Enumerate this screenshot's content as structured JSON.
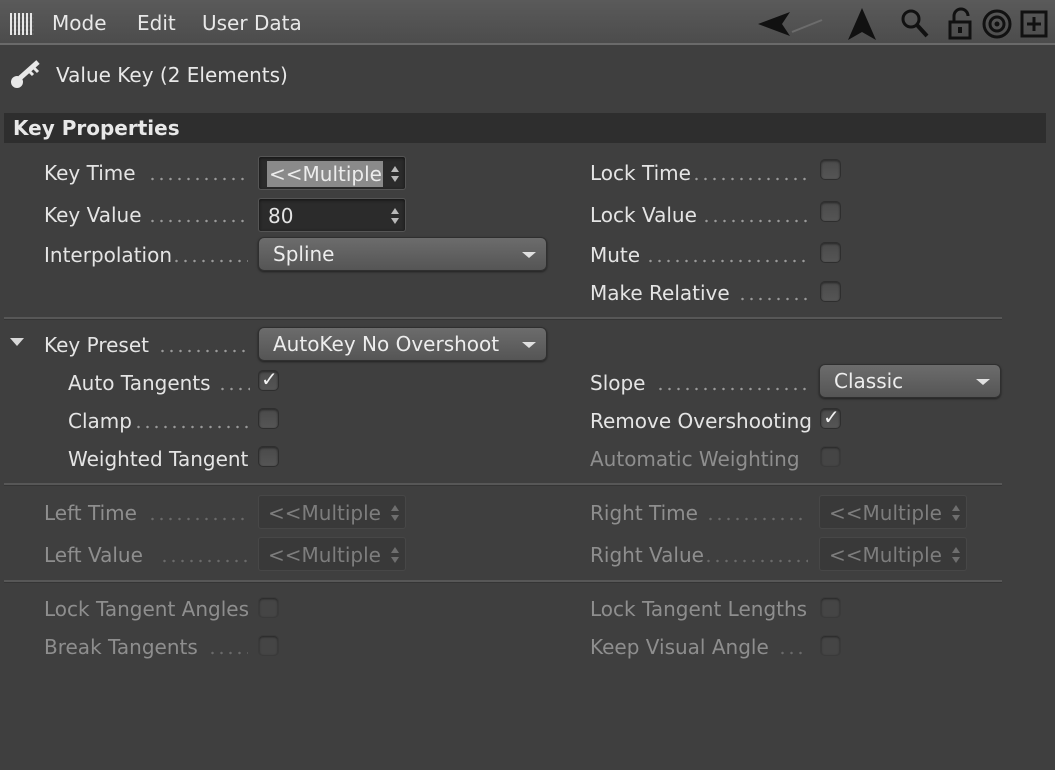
{
  "menubar": {
    "items": [
      "Mode",
      "Edit",
      "User Data"
    ]
  },
  "header": {
    "title": "Value Key (2 Elements)"
  },
  "section": {
    "title": "Key Properties"
  },
  "key": {
    "time_label": "Key Time",
    "time_value": "<<Multiple Values>>",
    "value_label": "Key Value",
    "value_value": "80",
    "interp_label": "Interpolation",
    "interp_value": "Spline",
    "lock_time_label": "Lock Time",
    "lock_value_label": "Lock Value",
    "mute_label": "Mute",
    "make_relative_label": "Make Relative"
  },
  "preset": {
    "label": "Key Preset",
    "value": "AutoKey No Overshoot",
    "auto_tangents_label": "Auto Tangents",
    "clamp_label": "Clamp",
    "weighted_label": "Weighted Tangent",
    "slope_label": "Slope",
    "slope_value": "Classic",
    "remove_overshoot_label": "Remove Overshooting",
    "auto_weighting_label": "Automatic Weighting"
  },
  "tangents": {
    "left_time_label": "Left  Time",
    "left_value_label": "Left  Value",
    "right_time_label": "Right Time",
    "right_value_label": "Right Value",
    "multiple": "<<Multiple Values>>"
  },
  "locks": {
    "lock_angles_label": "Lock Tangent Angles",
    "break_label": "Break Tangents",
    "lock_lengths_label": "Lock Tangent Lengths",
    "keep_visual_label": "Keep Visual Angle"
  },
  "checkmark": "✓"
}
